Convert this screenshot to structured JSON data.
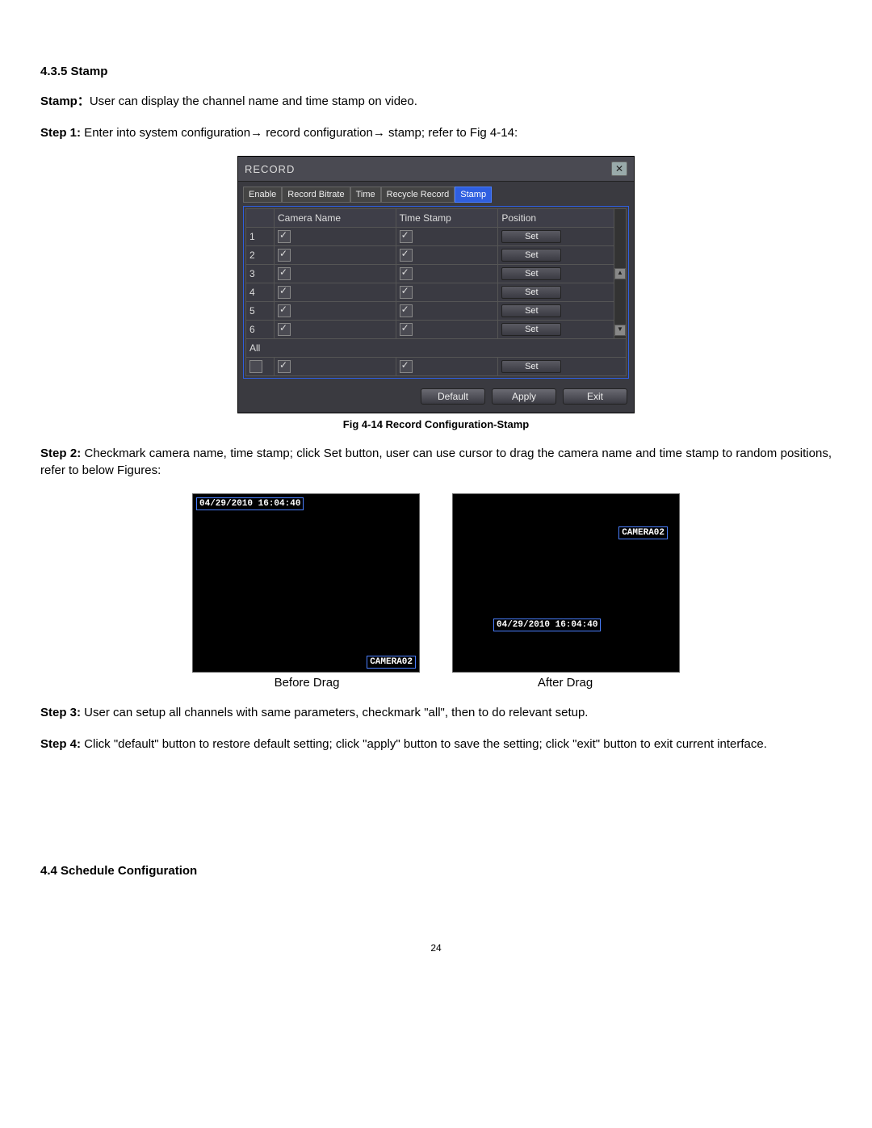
{
  "section435_heading": "4.3.5 Stamp",
  "intro_bold": "Stamp：",
  "intro_text": "User can display the channel name and time stamp on video.",
  "step1_bold": "Step 1:",
  "step1_text_a": " Enter into system configuration",
  "step1_text_b": " record configuration",
  "step1_text_c": " stamp; refer to Fig 4-14:",
  "arrow": "→",
  "dialog": {
    "title": "RECORD",
    "tabs": [
      "Enable",
      "Record Bitrate",
      "Time",
      "Recycle Record",
      "Stamp"
    ],
    "active_tab": 4,
    "cols": [
      "",
      "Camera Name",
      "Time Stamp",
      "Position"
    ],
    "rows": [
      {
        "n": "1",
        "cam": true,
        "ts": true,
        "btn": "Set"
      },
      {
        "n": "2",
        "cam": true,
        "ts": true,
        "btn": "Set"
      },
      {
        "n": "3",
        "cam": true,
        "ts": true,
        "btn": "Set"
      },
      {
        "n": "4",
        "cam": true,
        "ts": true,
        "btn": "Set"
      },
      {
        "n": "5",
        "cam": true,
        "ts": true,
        "btn": "Set"
      },
      {
        "n": "6",
        "cam": true,
        "ts": true,
        "btn": "Set"
      }
    ],
    "all_label": "All",
    "all_row": {
      "all": false,
      "cam": true,
      "ts": true,
      "btn": "Set"
    },
    "buttons": {
      "default": "Default",
      "apply": "Apply",
      "exit": "Exit"
    }
  },
  "fig_caption": "Fig 4-14 Record Configuration-Stamp",
  "step2_bold": "Step 2:",
  "step2_text": " Checkmark camera name, time stamp; click Set button, user can use cursor to drag the camera name and time stamp to random positions, refer to below Figures:",
  "drag": {
    "timestamp": "04/29/2010 16:04:40",
    "camera": "CAMERA02",
    "before_caption": "Before Drag",
    "after_caption": "After Drag"
  },
  "step3_bold": "Step 3:",
  "step3_text": " User can setup all channels with same parameters, checkmark \"all\", then to do relevant setup.",
  "step4_bold": "Step 4:",
  "step4_text": " Click \"default\" button to restore default setting; click \"apply\" button to save the setting; click \"exit\" button to exit current interface.",
  "section44_heading": "4.4 Schedule Configuration",
  "page_number": "24"
}
